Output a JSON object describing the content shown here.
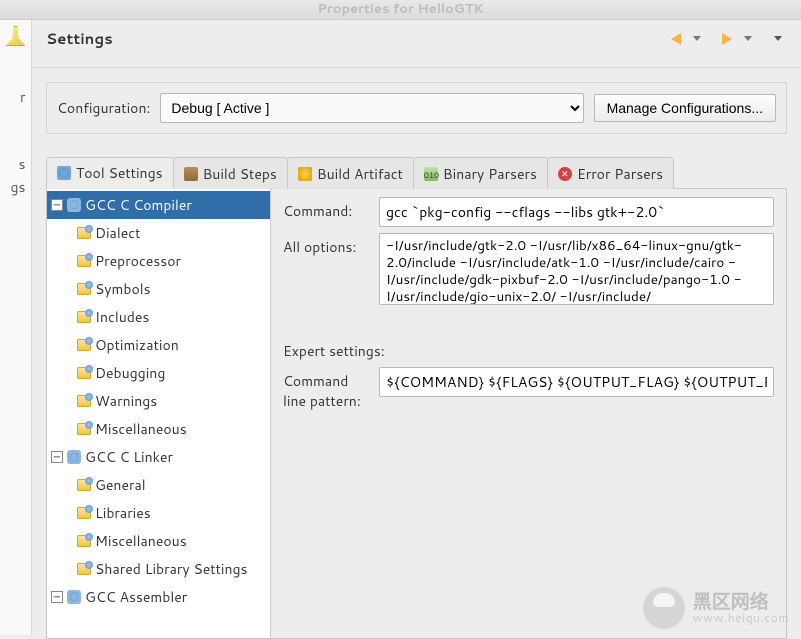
{
  "window": {
    "title": "Properties for HelloGTK"
  },
  "header": {
    "title": "Settings"
  },
  "left_truncated_chars": [
    "r",
    "s",
    "gs"
  ],
  "config": {
    "label": "Configuration:",
    "selected": "Debug  [ Active ]",
    "manage_btn": "Manage Configurations..."
  },
  "tabs": [
    {
      "id": "tool-settings",
      "label": "Tool Settings",
      "icon": "settings-icon"
    },
    {
      "id": "build-steps",
      "label": "Build Steps",
      "icon": "hammer-icon"
    },
    {
      "id": "build-artifact",
      "label": "Build Artifact",
      "icon": "artifact-icon"
    },
    {
      "id": "binary-parsers",
      "label": "Binary Parsers",
      "icon": "binary-icon"
    },
    {
      "id": "error-parsers",
      "label": "Error Parsers",
      "icon": "error-icon"
    }
  ],
  "tree": [
    {
      "label": "GCC C Compiler",
      "type": "group",
      "expanded": true,
      "selected": true
    },
    {
      "label": "Dialect",
      "type": "leaf"
    },
    {
      "label": "Preprocessor",
      "type": "leaf"
    },
    {
      "label": "Symbols",
      "type": "leaf"
    },
    {
      "label": "Includes",
      "type": "leaf"
    },
    {
      "label": "Optimization",
      "type": "leaf"
    },
    {
      "label": "Debugging",
      "type": "leaf"
    },
    {
      "label": "Warnings",
      "type": "leaf"
    },
    {
      "label": "Miscellaneous",
      "type": "leaf"
    },
    {
      "label": "GCC C Linker",
      "type": "group",
      "expanded": true
    },
    {
      "label": "General",
      "type": "leaf"
    },
    {
      "label": "Libraries",
      "type": "leaf"
    },
    {
      "label": "Miscellaneous",
      "type": "leaf"
    },
    {
      "label": "Shared Library Settings",
      "type": "leaf"
    },
    {
      "label": "GCC Assembler",
      "type": "group",
      "expanded": true
    }
  ],
  "form": {
    "command_label": "Command:",
    "command_value": "gcc `pkg-config --cflags --libs gtk+-2.0`",
    "alloptions_label": "All options:",
    "alloptions_value": "-I/usr/include/gtk-2.0 -I/usr/lib/x86_64-linux-gnu/gtk-2.0/include -I/usr/include/atk-1.0 -I/usr/include/cairo -I/usr/include/gdk-pixbuf-2.0 -I/usr/include/pango-1.0 -I/usr/include/gio-unix-2.0/ -I/usr/include/",
    "expert_label": "Expert settings:",
    "pattern_label": "Command\nline pattern:",
    "pattern_value": "${COMMAND} ${FLAGS} ${OUTPUT_FLAG} ${OUTPUT_PRE"
  },
  "watermark": {
    "line1": "黑区网络",
    "line2": "www.heiqu.com"
  }
}
